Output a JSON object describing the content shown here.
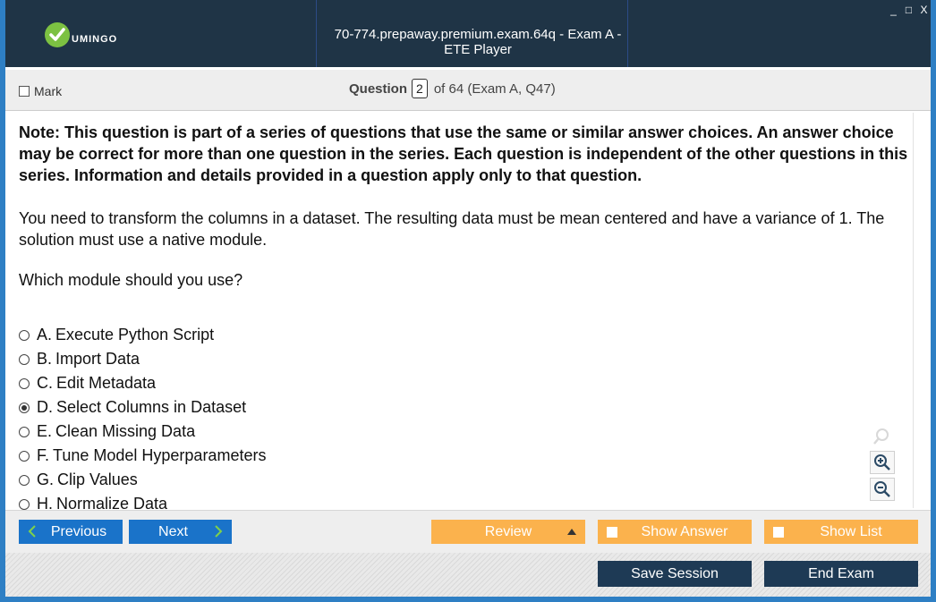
{
  "window": {
    "title": "70-774.prepaway.premium.exam.64q - Exam A - ETE Player",
    "controls": [
      "_",
      "□",
      "X"
    ]
  },
  "logo": {
    "text": "UMINGO",
    "accent": "#7cc142"
  },
  "question_bar": {
    "mark_label": "Mark",
    "question_label": "Question",
    "question_number": "2",
    "of_text": "of 64 (Exam A, Q47)"
  },
  "question": {
    "note": "Note: This question is part of a series of questions that use the same or similar answer choices. An answer choice may be correct for more than one question in the series. Each question is independent of the other questions in this series. Information and details provided in a question apply only to that question.",
    "stem": "You need to transform the columns in a dataset. The resulting data must be mean centered and have a variance of 1. The solution must use a native module.",
    "ask": "Which module should you use?",
    "options": [
      {
        "letter": "A.",
        "text": "Execute Python Script",
        "selected": false
      },
      {
        "letter": "B.",
        "text": "Import Data",
        "selected": false
      },
      {
        "letter": "C.",
        "text": "Edit Metadata",
        "selected": false
      },
      {
        "letter": "D.",
        "text": "Select Columns in Dataset",
        "selected": true
      },
      {
        "letter": "E.",
        "text": "Clean Missing Data",
        "selected": false
      },
      {
        "letter": "F.",
        "text": "Tune Model Hyperparameters",
        "selected": false
      },
      {
        "letter": "G.",
        "text": "Clip Values",
        "selected": false
      },
      {
        "letter": "H.",
        "text": "Normalize Data",
        "selected": false
      }
    ]
  },
  "nav": {
    "previous": "Previous",
    "next": "Next",
    "review": "Review",
    "show_answer": "Show Answer",
    "show_list": "Show List"
  },
  "footer": {
    "save_session": "Save Session",
    "end_exam": "End Exam"
  },
  "colors": {
    "header_bg": "#1f3446",
    "frame": "#2e7fc4",
    "nav_blue": "#1a73c9",
    "orange": "#fbb24d",
    "dark_button": "#1e3a55"
  }
}
